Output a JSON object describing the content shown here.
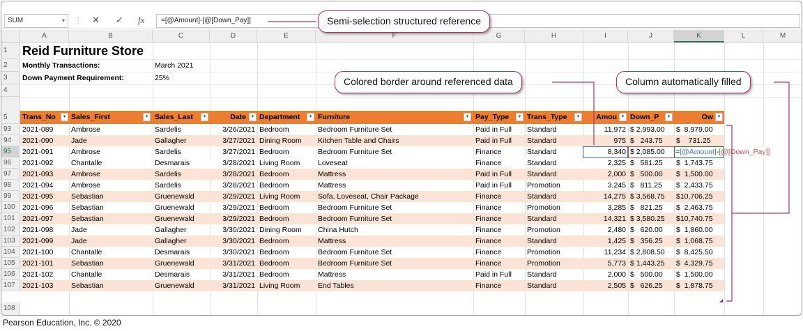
{
  "formula_bar": {
    "name_box": "SUM",
    "cancel_icon": "✕",
    "enter_icon": "✓",
    "fx_icon": "fx",
    "formula": "=[@Amount]-[@[Down_Pay]]"
  },
  "columns": [
    "A",
    "B",
    "C",
    "D",
    "E",
    "F",
    "G",
    "H",
    "I",
    "J",
    "K",
    "L",
    "M"
  ],
  "header_rows": {
    "r1": {
      "num": "1",
      "A": "Reid Furniture Store"
    },
    "r2": {
      "num": "2",
      "A": "Monthly Transactions:",
      "C": "March 2021"
    },
    "r3": {
      "num": "3",
      "A": "Down Payment Requirement:",
      "C": "25%"
    },
    "r4": {
      "num": "4"
    },
    "r5": {
      "num": "5"
    }
  },
  "table_headers": [
    "Trans_No",
    "Sales_First",
    "Sales_Last",
    "Date",
    "Department",
    "Furniture",
    "Pay_Type",
    "Trans_Type",
    "Amou",
    "Down_P",
    "Ow"
  ],
  "rows": [
    {
      "num": "93",
      "A": "2021-089",
      "B": "Ambrose",
      "C": "Sardelis",
      "D": "3/26/2021",
      "E": "Bedroom",
      "F": "Bedroom Furniture Set",
      "G": "Paid in Full",
      "H": "Standard",
      "I": "11,972",
      "J": "$ 2,993.00",
      "K": "$  8,979.00"
    },
    {
      "num": "94",
      "A": "2021-090",
      "B": "Jade",
      "C": "Gallagher",
      "D": "3/27/2021",
      "E": "Dining Room",
      "F": "Kitchen Table and Chairs",
      "G": "Paid in Full",
      "H": "Standard",
      "I": "975",
      "J": "$   243.75",
      "K": "$    731.25"
    },
    {
      "num": "95",
      "A": "2021-091",
      "B": "Ambrose",
      "C": "Sardelis",
      "D": "3/27/2021",
      "E": "Bedroom",
      "F": "Bedroom Furniture Set",
      "G": "Finance",
      "H": "Standard",
      "I": "8,340",
      "J": "$ 2,085.00",
      "K": ""
    },
    {
      "num": "96",
      "A": "2021-092",
      "B": "Chantalle",
      "C": "Desmarais",
      "D": "3/28/2021",
      "E": "Living Room",
      "F": "Loveseat",
      "G": "Finance",
      "H": "Standard",
      "I": "2,325",
      "J": "$   581.25",
      "K": "$  1,743.75"
    },
    {
      "num": "97",
      "A": "2021-093",
      "B": "Ambrose",
      "C": "Sardelis",
      "D": "3/28/2021",
      "E": "Bedroom",
      "F": "Mattress",
      "G": "Paid in Full",
      "H": "Standard",
      "I": "2,000",
      "J": "$   500.00",
      "K": "$  1,500.00"
    },
    {
      "num": "98",
      "A": "2021-094",
      "B": "Ambrose",
      "C": "Sardelis",
      "D": "3/28/2021",
      "E": "Bedroom",
      "F": "Mattress",
      "G": "Paid in Full",
      "H": "Promotion",
      "I": "3,245",
      "J": "$   811.25",
      "K": "$  2,433.75"
    },
    {
      "num": "99",
      "A": "2021-095",
      "B": "Sebastian",
      "C": "Gruenewald",
      "D": "3/29/2021",
      "E": "Living Room",
      "F": "Sofa, Loveseat, Chair Package",
      "G": "Finance",
      "H": "Standard",
      "I": "14,275",
      "J": "$ 3,568.75",
      "K": "$10,706.25"
    },
    {
      "num": "100",
      "A": "2021-096",
      "B": "Sebastian",
      "C": "Gruenewald",
      "D": "3/29/2021",
      "E": "Bedroom",
      "F": "Bedroom Furniture Set",
      "G": "Finance",
      "H": "Promotion",
      "I": "3,285",
      "J": "$   821.25",
      "K": "$  2,463.75"
    },
    {
      "num": "101",
      "A": "2021-097",
      "B": "Sebastian",
      "C": "Gruenewald",
      "D": "3/29/2021",
      "E": "Bedroom",
      "F": "Bedroom Furniture Set",
      "G": "Finance",
      "H": "Standard",
      "I": "14,321",
      "J": "$ 3,580.25",
      "K": "$10,740.75"
    },
    {
      "num": "102",
      "A": "2021-098",
      "B": "Jade",
      "C": "Gallagher",
      "D": "3/30/2021",
      "E": "Dining Room",
      "F": "China Hutch",
      "G": "Finance",
      "H": "Promotion",
      "I": "2,480",
      "J": "$   620.00",
      "K": "$  1,860.00"
    },
    {
      "num": "103",
      "A": "2021-099",
      "B": "Jade",
      "C": "Gallagher",
      "D": "3/30/2021",
      "E": "Bedroom",
      "F": "Mattress",
      "G": "Finance",
      "H": "Standard",
      "I": "1,425",
      "J": "$   356.25",
      "K": "$  1,068.75"
    },
    {
      "num": "104",
      "A": "2021-100",
      "B": "Chantalle",
      "C": "Desmarais",
      "D": "3/30/2021",
      "E": "Bedroom",
      "F": "Bedroom Furniture Set",
      "G": "Finance",
      "H": "Promotion",
      "I": "11,234",
      "J": "$ 2,808.50",
      "K": "$  8,425.50"
    },
    {
      "num": "105",
      "A": "2021-101",
      "B": "Sebastian",
      "C": "Gruenewald",
      "D": "3/31/2021",
      "E": "Bedroom",
      "F": "Bedroom Furniture Set",
      "G": "Finance",
      "H": "Promotion",
      "I": "5,773",
      "J": "$ 1,443.25",
      "K": "$  4,329.75"
    },
    {
      "num": "106",
      "A": "2021-102",
      "B": "Chantalle",
      "C": "Desmarais",
      "D": "3/31/2021",
      "E": "Bedroom",
      "F": "Mattress",
      "G": "Paid in Full",
      "H": "Standard",
      "I": "2,000",
      "J": "$   500.00",
      "K": "$  1,500.00"
    },
    {
      "num": "107",
      "A": "2021-103",
      "B": "Sebastian",
      "C": "Gruenewald",
      "D": "3/31/2021",
      "E": "Living Room",
      "F": "End Tables",
      "G": "Finance",
      "H": "Standard",
      "I": "2,505",
      "J": "$   626.25",
      "K": "$  1,878.75"
    }
  ],
  "last_row_num": "108",
  "active_cell_formula": {
    "eq": "=",
    "amount_ref": "[@Amount]",
    "minus": "-",
    "down_ref": "[@[Down_Pay]]"
  },
  "callouts": {
    "semi_selection": "Semi-selection structured reference",
    "colored_border": "Colored border around referenced data",
    "auto_filled": "Column automatically filled"
  },
  "colors": {
    "header_orange": "#ed7d31",
    "band": "#fbe4d5",
    "callout_border": "#b0306a",
    "amount_ref": "#4472c4",
    "down_ref": "#c0504d"
  },
  "footer": "Pearson Education, Inc. © 2020"
}
